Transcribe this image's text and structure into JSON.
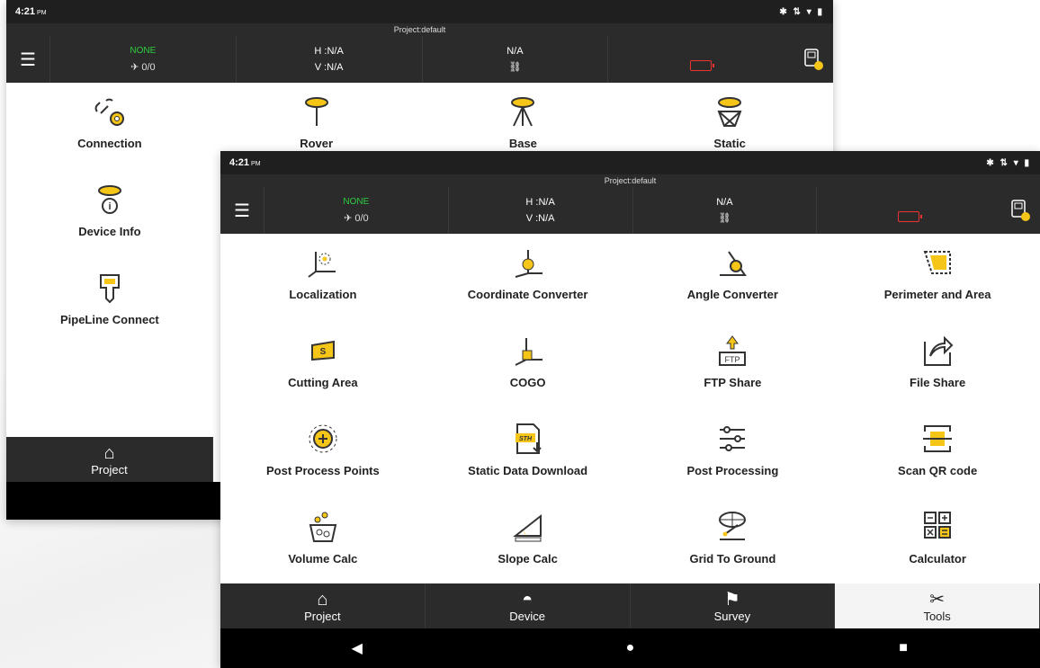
{
  "back_screen": {
    "status": {
      "time": "4:21",
      "ampm": "PM"
    },
    "project": "Project:default",
    "info": {
      "fix": "NONE",
      "sats": "0/0",
      "h": "H :N/A",
      "v": "V :N/A",
      "link": "N/A"
    },
    "tiles": [
      {
        "label": "Connection",
        "icon": "link-gear-icon"
      },
      {
        "label": "Rover",
        "icon": "rover-icon"
      },
      {
        "label": "Base",
        "icon": "base-tripod-icon"
      },
      {
        "label": "Static",
        "icon": "static-icon"
      },
      {
        "label": "Device Info",
        "icon": "device-info-icon"
      },
      {
        "label": "PipeLine Connect",
        "icon": "pipeline-icon"
      }
    ],
    "tabs": [
      {
        "label": "Project",
        "icon": "home-icon"
      }
    ]
  },
  "front_screen": {
    "status": {
      "time": "4:21",
      "ampm": "PM"
    },
    "project": "Project:default",
    "info": {
      "fix": "NONE",
      "sats": "0/0",
      "h": "H :N/A",
      "v": "V :N/A",
      "link": "N/A"
    },
    "tiles": [
      {
        "label": "Localization",
        "icon": "localization-icon"
      },
      {
        "label": "Coordinate Converter",
        "icon": "coordinate-converter-icon"
      },
      {
        "label": "Angle Converter",
        "icon": "angle-converter-icon"
      },
      {
        "label": "Perimeter and Area",
        "icon": "perimeter-area-icon"
      },
      {
        "label": "Cutting Area",
        "icon": "cutting-area-icon"
      },
      {
        "label": "COGO",
        "icon": "cogo-icon"
      },
      {
        "label": "FTP Share",
        "icon": "ftp-share-icon"
      },
      {
        "label": "File Share",
        "icon": "file-share-icon"
      },
      {
        "label": "Post Process Points",
        "icon": "post-process-points-icon"
      },
      {
        "label": "Static Data Download",
        "icon": "static-data-download-icon"
      },
      {
        "label": "Post Processing",
        "icon": "post-processing-icon"
      },
      {
        "label": "Scan QR code",
        "icon": "scan-qr-icon"
      },
      {
        "label": "Volume Calc",
        "icon": "volume-calc-icon"
      },
      {
        "label": "Slope Calc",
        "icon": "slope-calc-icon"
      },
      {
        "label": "Grid To Ground",
        "icon": "grid-to-ground-icon"
      },
      {
        "label": "Calculator",
        "icon": "calculator-icon"
      }
    ],
    "tabs": [
      {
        "label": "Project",
        "icon": "home-icon"
      },
      {
        "label": "Device",
        "icon": "device-icon"
      },
      {
        "label": "Survey",
        "icon": "survey-icon"
      },
      {
        "label": "Tools",
        "icon": "tools-icon",
        "active": true
      }
    ],
    "ftp_text": "FTP",
    "sth_text": "STH"
  },
  "colors": {
    "accent": "#f5c518",
    "bar": "#2b2b2b",
    "fix": "#2ecc40",
    "battery": "#e33333"
  }
}
